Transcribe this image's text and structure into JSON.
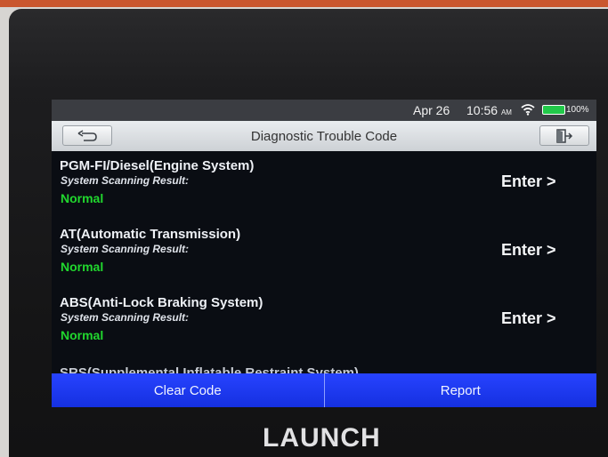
{
  "statusbar": {
    "date": "Apr 26",
    "time": "10:56",
    "ampm": "AM",
    "battery": "100%",
    "battery_level": 1.0,
    "icons": [
      "wifi-icon",
      "battery-icon"
    ]
  },
  "header": {
    "title": "Diagnostic Trouble Code",
    "back_icon": "back-arrow-icon",
    "exit_icon": "exit-icon"
  },
  "systems": [
    {
      "name": "PGM-FI/Diesel(Engine System)",
      "scan_label": "System Scanning Result:",
      "result": "Normal",
      "action": "Enter >"
    },
    {
      "name": "AT(Automatic Transmission)",
      "scan_label": "System Scanning Result:",
      "result": "Normal",
      "action": "Enter >"
    },
    {
      "name": "ABS(Anti-Lock Braking System)",
      "scan_label": "System Scanning Result:",
      "result": "Normal",
      "action": "Enter >"
    },
    {
      "name": "SRS(Supplemental Inflatable Restraint System)"
    }
  ],
  "actions": {
    "clear": "Clear Code",
    "report": "Report"
  },
  "brand": "LAUNCH",
  "colors": {
    "accent": "#1f3cf5",
    "result_ok": "#21d72e",
    "header_bg": "#dcdfe2",
    "screen_bg": "#0a0d13"
  }
}
